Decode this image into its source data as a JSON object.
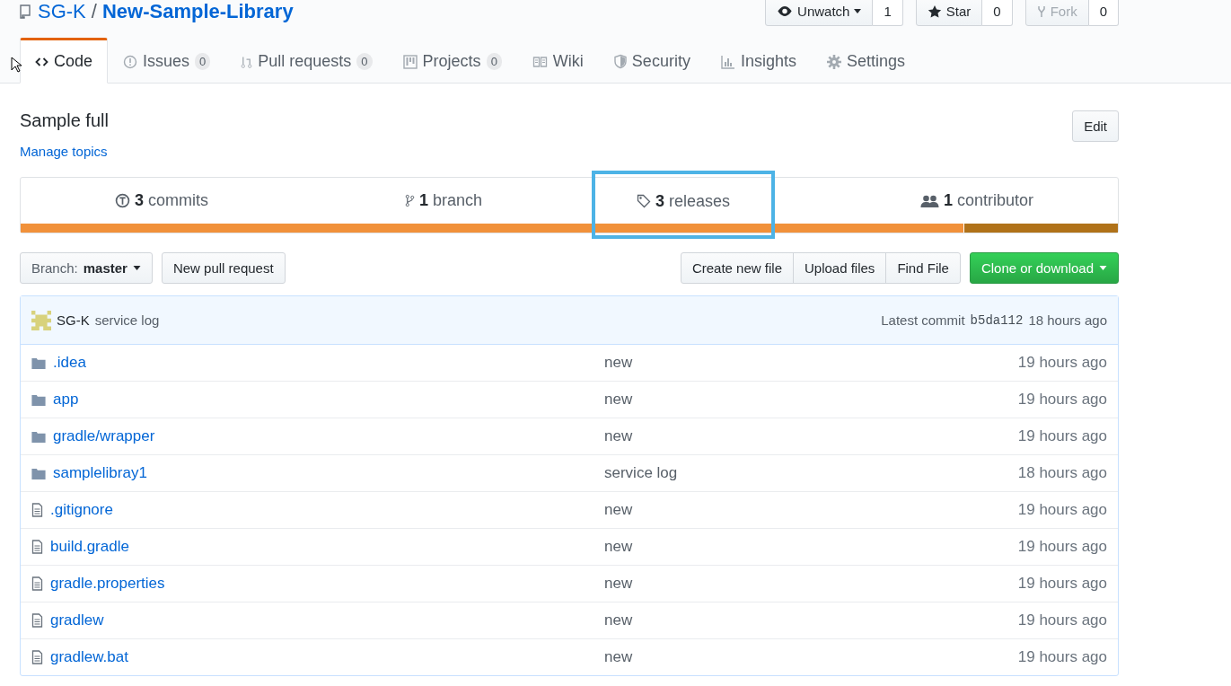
{
  "repo": {
    "owner": "SG-K",
    "separator": "/",
    "name": "New-Sample-Library"
  },
  "actions": [
    {
      "kind": "watch",
      "label": "Unwatch",
      "count": "1",
      "disabled": false
    },
    {
      "kind": "star",
      "label": "Star",
      "count": "0",
      "disabled": false
    },
    {
      "kind": "fork",
      "label": "Fork",
      "count": "0",
      "disabled": true
    }
  ],
  "tabs": [
    {
      "kind": "code",
      "label": "Code",
      "selected": true
    },
    {
      "kind": "issues",
      "label": "Issues",
      "count": "0",
      "selected": false
    },
    {
      "kind": "pulls",
      "label": "Pull requests",
      "count": "0",
      "selected": false
    },
    {
      "kind": "projects",
      "label": "Projects",
      "count": "0",
      "selected": false
    },
    {
      "kind": "wiki",
      "label": "Wiki",
      "selected": false
    },
    {
      "kind": "security",
      "label": "Security",
      "selected": false
    },
    {
      "kind": "insights",
      "label": "Insights",
      "selected": false
    },
    {
      "kind": "settings",
      "label": "Settings",
      "selected": false
    }
  ],
  "description": "Sample full",
  "edit_button": "Edit",
  "topics_link": "Manage topics",
  "stats": [
    {
      "kind": "commits",
      "number": "3",
      "label": "commits",
      "highlighted": false
    },
    {
      "kind": "branch",
      "number": "1",
      "label": "branch",
      "highlighted": false
    },
    {
      "kind": "releases",
      "number": "3",
      "label": "releases",
      "highlighted": true
    },
    {
      "kind": "contributors",
      "number": "1",
      "label": "contributor",
      "highlighted": false
    }
  ],
  "languages": [
    {
      "color": "#f1913a",
      "level": 0.86
    },
    {
      "color": "#b07219",
      "level": 0.14
    }
  ],
  "branch_select": {
    "label": "Branch:",
    "value": "master"
  },
  "new_pr_button": "New pull request",
  "file_buttons": [
    "Create new file",
    "Upload files",
    "Find File"
  ],
  "clone_button": "Clone or download",
  "commit": {
    "author": "SG-K",
    "message": "service log",
    "prefix": "Latest commit",
    "sha": "b5da112",
    "age": "18 hours ago"
  },
  "files": [
    {
      "kind": "folder",
      "name": ".idea",
      "message": "new",
      "age": "19 hours ago"
    },
    {
      "kind": "folder",
      "name": "app",
      "message": "new",
      "age": "19 hours ago"
    },
    {
      "kind": "folder",
      "name": "gradle/wrapper",
      "message": "new",
      "age": "19 hours ago"
    },
    {
      "kind": "folder",
      "name": "samplelibray1",
      "message": "service log",
      "age": "18 hours ago"
    },
    {
      "kind": "file",
      "name": ".gitignore",
      "message": "new",
      "age": "19 hours ago"
    },
    {
      "kind": "file",
      "name": "build.gradle",
      "message": "new",
      "age": "19 hours ago"
    },
    {
      "kind": "file",
      "name": "gradle.properties",
      "message": "new",
      "age": "19 hours ago"
    },
    {
      "kind": "file",
      "name": "gradlew",
      "message": "new",
      "age": "19 hours ago"
    },
    {
      "kind": "file",
      "name": "gradlew.bat",
      "message": "new",
      "age": "19 hours ago"
    }
  ]
}
